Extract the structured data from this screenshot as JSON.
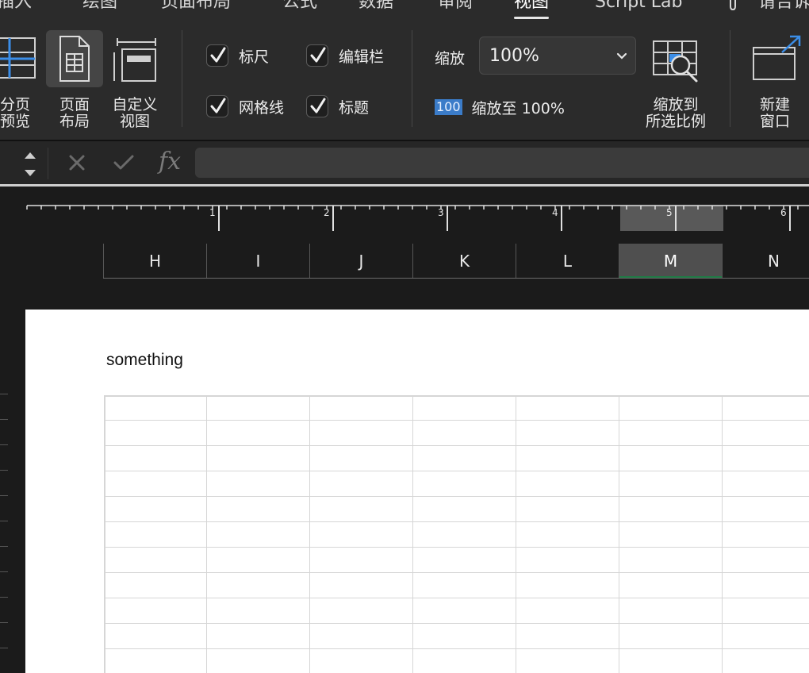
{
  "menu": {
    "tabs": [
      {
        "label": "插入",
        "active": false
      },
      {
        "label": "绘图",
        "active": false
      },
      {
        "label": "页面布局",
        "active": false
      },
      {
        "label": "公式",
        "active": false
      },
      {
        "label": "数据",
        "active": false
      },
      {
        "label": "审阅",
        "active": false
      },
      {
        "label": "视图",
        "active": true
      },
      {
        "label": "Script Lab",
        "active": false
      },
      {
        "label": "请告诉",
        "active": false
      }
    ]
  },
  "ribbon": {
    "page_break": {
      "line1": "分页",
      "line2": "预览"
    },
    "page_layout": {
      "line1": "页面",
      "line2": "布局"
    },
    "custom_view": {
      "line1": "自定义",
      "line2": "视图"
    },
    "checks": {
      "ruler": "标尺",
      "formula_bar": "编辑栏",
      "gridlines": "网格线",
      "headings": "标题"
    },
    "zoom": {
      "label": "缩放",
      "value": "100%",
      "badge": "100",
      "zoom_to_100": "缩放至 100%"
    },
    "zoom_selection": {
      "line1": "缩放到",
      "line2": "所选比例"
    },
    "new_window": {
      "line1": "新建",
      "line2": "窗口"
    }
  },
  "formula_bar": {
    "fx": "fx",
    "value": ""
  },
  "ruler": {
    "numbers": [
      "1",
      "2",
      "3",
      "4",
      "5",
      "6"
    ]
  },
  "columns": [
    {
      "label": "H",
      "selected": false
    },
    {
      "label": "I",
      "selected": false
    },
    {
      "label": "J",
      "selected": false
    },
    {
      "label": "K",
      "selected": false
    },
    {
      "label": "L",
      "selected": false
    },
    {
      "label": "M",
      "selected": true
    },
    {
      "label": "N",
      "selected": false
    }
  ],
  "sheet": {
    "header_text": "something",
    "row_count": 11
  },
  "colors": {
    "accent": "#3b7cc9",
    "selected_column": "#1f7a45",
    "ribbon_bg": "#2b2b2b"
  }
}
